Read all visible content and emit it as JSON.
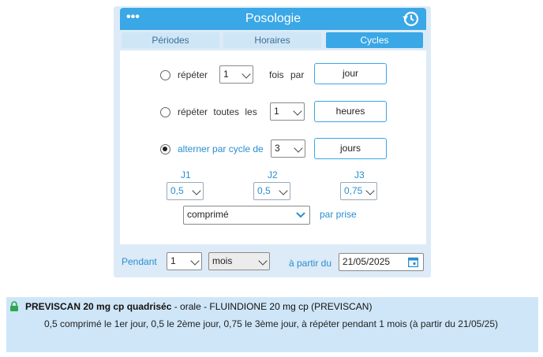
{
  "header": {
    "title": "Posologie",
    "menu_icon": "more-dots-icon",
    "history_icon": "history-icon"
  },
  "tabs": [
    {
      "label": "Périodes",
      "active": false
    },
    {
      "label": "Horaires",
      "active": false
    },
    {
      "label": "Cycles",
      "active": true
    }
  ],
  "row1": {
    "label_a": "répéter",
    "select": "1",
    "label_b": "fois par",
    "unit": "jour"
  },
  "row2": {
    "label_a": "répéter toutes les",
    "select": "1",
    "unit": "heures"
  },
  "row3": {
    "label_a": "alterner par cycle de",
    "select": "3",
    "unit": "jours"
  },
  "cycles": [
    {
      "day": "J1",
      "value": "0,5"
    },
    {
      "day": "J2",
      "value": "0,5"
    },
    {
      "day": "J3",
      "value": "0,75"
    }
  ],
  "form": {
    "value": "comprimé",
    "suffix": "par prise"
  },
  "duration": {
    "label": "Pendant",
    "count": "1",
    "unit": "mois",
    "from_label": "à partir du",
    "date": "21/05/2025",
    "calendar_icon": "calendar-icon"
  },
  "summary": {
    "drug_bold": "PREVISCAN 20 mg cp quadriséc",
    "drug_rest": " - orale - FLUINDIONE 20 mg cp (PREVISCAN)",
    "detail": "0,5 comprimé le 1er jour, 0,5 le 2ème jour, 0,75 le 3ème jour, à répéter pendant 1 mois (à partir du 21/05/25)",
    "lock_icon": "lock-icon",
    "lock_color": "#2fa84f"
  },
  "colors": {
    "accent": "#3aa7e6",
    "panel": "#dcebf7",
    "summary_bg": "#cfe6f8"
  }
}
